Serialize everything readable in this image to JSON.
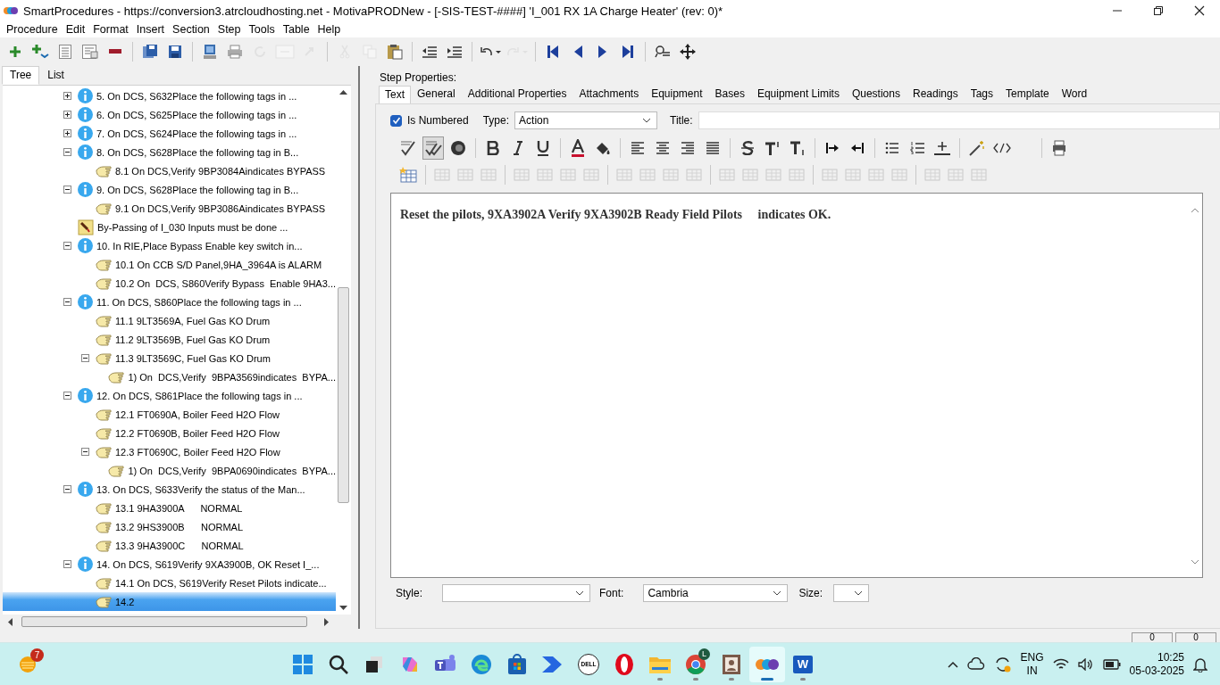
{
  "window": {
    "title": "SmartProcedures - https://conversion3.atrcloudhosting.net - MotivaPRODNew - [-SIS-TEST-####] 'I_001 RX 1A Charge Heater' (rev: 0)*"
  },
  "menu": [
    "Procedure",
    "Edit",
    "Format",
    "Insert",
    "Section",
    "Step",
    "Tools",
    "Table",
    "Help"
  ],
  "toolbar": [
    [
      {
        "disabled": false
      },
      {
        "disabled": false
      },
      {
        "disabled": false
      },
      {
        "disabled": false
      },
      {
        "disabled": false
      }
    ],
    [
      {
        "disabled": false
      },
      {
        "disabled": false
      }
    ],
    [
      {
        "disabled": false
      },
      {
        "disabled": false
      },
      {
        "disabled": true
      },
      {
        "disabled": true
      },
      {
        "disabled": true
      }
    ],
    [
      {
        "disabled": true
      },
      {
        "disabled": true
      },
      {
        "disabled": false
      }
    ],
    [
      {
        "disabled": false
      },
      {
        "disabled": false
      }
    ],
    [
      {
        "disabled": false
      },
      {
        "disabled": true
      }
    ],
    [
      {
        "disabled": false
      },
      {
        "disabled": false
      },
      {
        "disabled": false
      },
      {
        "disabled": false
      }
    ],
    [
      {
        "disabled": false
      },
      {
        "disabled": false
      }
    ]
  ],
  "left_tabs": [
    {
      "label": "Tree",
      "selected": true
    },
    {
      "label": "List",
      "selected": false
    }
  ],
  "tree": [
    {
      "kind": "info",
      "label": "5. On DCS, S632Place the following tags in ...",
      "expanded": false,
      "selected": false
    },
    {
      "kind": "info",
      "label": "6. On DCS, S625Place the following tags in ...",
      "expanded": false,
      "selected": false
    },
    {
      "kind": "info",
      "label": "7. On DCS, S624Place the following tags in ...",
      "expanded": false,
      "selected": false
    },
    {
      "kind": "info",
      "label": "8. On DCS, S628Place the following tag in B...",
      "expanded": true,
      "selected": false,
      "children": [
        {
          "kind": "hand",
          "label": "8.1 On DCS,Verify 9BP3084Aindicates BYPASS",
          "selected": false
        }
      ]
    },
    {
      "kind": "info",
      "label": "9. On DCS, S628Place the following tag in B...",
      "expanded": true,
      "selected": false,
      "children": [
        {
          "kind": "hand",
          "label": "9.1 On DCS,Verify 9BP3086Aindicates BYPASS",
          "selected": false
        }
      ]
    },
    {
      "kind": "note",
      "label": "By-Passing of I_030 Inputs must be done ...",
      "selected": false
    },
    {
      "kind": "info",
      "label": "10. In RIE,Place Bypass Enable key switch in...",
      "expanded": true,
      "selected": false,
      "children": [
        {
          "kind": "hand",
          "label": "10.1 On CCB S/D Panel,9HA_3964A is ALARM",
          "selected": false
        },
        {
          "kind": "hand",
          "label": "10.2 On  DCS, S860Verify Bypass  Enable 9HA3...",
          "selected": false
        }
      ]
    },
    {
      "kind": "info",
      "label": "11. On DCS, S860Place the following tags in ...",
      "expanded": true,
      "selected": false,
      "children": [
        {
          "kind": "hand",
          "label": "11.1 9LT3569A, Fuel Gas KO Drum",
          "selected": false
        },
        {
          "kind": "hand",
          "label": "11.2 9LT3569B, Fuel Gas KO Drum",
          "selected": false
        },
        {
          "kind": "hand",
          "label": "11.3 9LT3569C, Fuel Gas KO Drum",
          "expanded": true,
          "selected": false,
          "children": [
            {
              "kind": "hand",
              "label": "1) On  DCS,Verify  9BPA3569indicates  BYPA...",
              "selected": false
            }
          ]
        }
      ]
    },
    {
      "kind": "info",
      "label": "12. On DCS, S861Place the following tags in ...",
      "expanded": true,
      "selected": false,
      "children": [
        {
          "kind": "hand",
          "label": "12.1 FT0690A, Boiler Feed H2O Flow",
          "selected": false
        },
        {
          "kind": "hand",
          "label": "12.2 FT0690B, Boiler Feed H2O Flow",
          "selected": false
        },
        {
          "kind": "hand",
          "label": "12.3 FT0690C, Boiler Feed H2O Flow",
          "expanded": true,
          "selected": false,
          "children": [
            {
              "kind": "hand",
              "label": "1) On  DCS,Verify  9BPA0690indicates  BYPA...",
              "selected": false
            }
          ]
        }
      ]
    },
    {
      "kind": "info",
      "label": "13. On DCS, S633Verify the status of the Man...",
      "expanded": true,
      "selected": false,
      "children": [
        {
          "kind": "hand",
          "label": "13.1 9HA3900A      NORMAL",
          "selected": false
        },
        {
          "kind": "hand",
          "label": "13.2 9HS3900B      NORMAL",
          "selected": false
        },
        {
          "kind": "hand",
          "label": "13.3 9HA3900C      NORMAL",
          "selected": false
        }
      ]
    },
    {
      "kind": "info",
      "label": "14. On DCS, S619Verify 9XA3900B, OK Reset I_...",
      "expanded": true,
      "selected": false,
      "children": [
        {
          "kind": "hand",
          "label": "14.1 On DCS, S619Verify Reset Pilots indicate...",
          "selected": false
        },
        {
          "kind": "hand",
          "label": "14.2",
          "selected": true
        }
      ]
    }
  ],
  "step_properties": {
    "heading": "Step Properties:",
    "tabs": [
      {
        "label": "Text",
        "selected": true
      },
      {
        "label": "General",
        "selected": false
      },
      {
        "label": "Additional Properties",
        "selected": false
      },
      {
        "label": "Attachments",
        "selected": false
      },
      {
        "label": "Equipment",
        "selected": false
      },
      {
        "label": "Bases",
        "selected": false
      },
      {
        "label": "Equipment Limits",
        "selected": false
      },
      {
        "label": "Questions",
        "selected": false
      },
      {
        "label": "Readings",
        "selected": false
      },
      {
        "label": "Tags",
        "selected": false
      },
      {
        "label": "Template",
        "selected": false
      },
      {
        "label": "Word",
        "selected": false
      }
    ],
    "is_numbered": {
      "label": "Is Numbered",
      "checked": true
    },
    "type": {
      "label": "Type:",
      "value": "Action"
    },
    "title": {
      "label": "Title:"
    },
    "format_toolbar": [
      {
        "disabled": false,
        "on": false
      },
      {
        "disabled": false,
        "on": true
      },
      {
        "disabled": false,
        "on": false
      }
    ],
    "editor_text": "Reset the pilots, 9XA3902A Verify 9XA3902B Ready Field Pilots     indicates OK.",
    "style": {
      "label": "Style:"
    },
    "font": {
      "label": "Font:",
      "value": "Cambria"
    },
    "size": {
      "label": "Size:"
    }
  },
  "status_bar": [
    "0",
    "0"
  ],
  "taskbar": {
    "weather_badge": "7",
    "chrome_badge": "L",
    "dell_label": "DELL",
    "word_label": "W",
    "apps": [
      {
        "running": false,
        "selected": false
      },
      {
        "running": false,
        "selected": false
      },
      {
        "running": false,
        "selected": false
      },
      {
        "running": false,
        "selected": false
      },
      {
        "running": false,
        "selected": false
      },
      {
        "running": false,
        "selected": false
      },
      {
        "running": false,
        "selected": false
      },
      {
        "running": false,
        "selected": false
      },
      {
        "running": false,
        "selected": false
      },
      {
        "running": false,
        "selected": false
      },
      {
        "running": true,
        "selected": false
      },
      {
        "running": true,
        "selected": false
      },
      {
        "running": true,
        "selected": false
      },
      {
        "running": true,
        "selected": true
      },
      {
        "running": true,
        "selected": false
      }
    ],
    "language": "ENG",
    "region": "IN",
    "time": "10:25",
    "date": "05-03-2025"
  }
}
